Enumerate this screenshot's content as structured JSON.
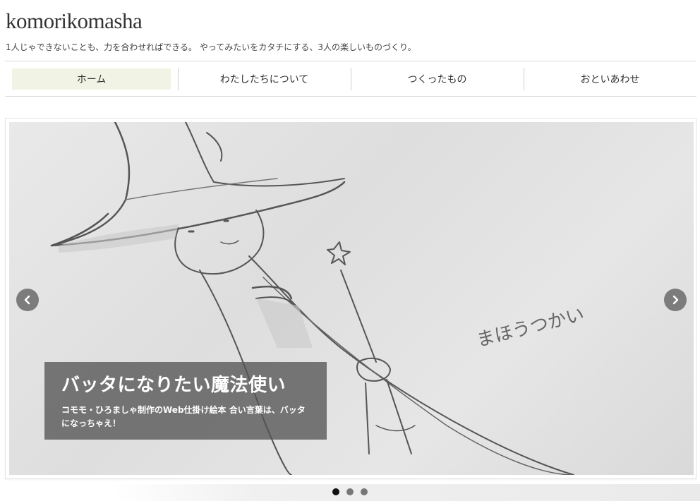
{
  "site": {
    "title": "komorikomasha",
    "tagline": "1人じゃできないことも、力を合わせればできる。 やってみたいをカタチにする、3人の楽しいものづくり。"
  },
  "nav": {
    "items": [
      {
        "label": "ホーム"
      },
      {
        "label": "わたしたちについて"
      },
      {
        "label": "つくったもの"
      },
      {
        "label": "おといあわせ"
      }
    ],
    "active_index": 0
  },
  "slider": {
    "caption_title": "バッタになりたい魔法使い",
    "caption_text": "コモモ・ひろましゃ制作のWeb仕掛け絵本 合い言葉は、バッタになっちゃえ！",
    "image_text": "まほうつかい",
    "prev_icon": "chevron-left-icon",
    "next_icon": "chevron-right-icon",
    "dots_count": 3,
    "active_dot": 0
  },
  "colors": {
    "active_nav_bg": "#f1f3e4",
    "caption_bg": "#555555",
    "dot_active": "#111111",
    "dot_inactive": "#777777"
  }
}
